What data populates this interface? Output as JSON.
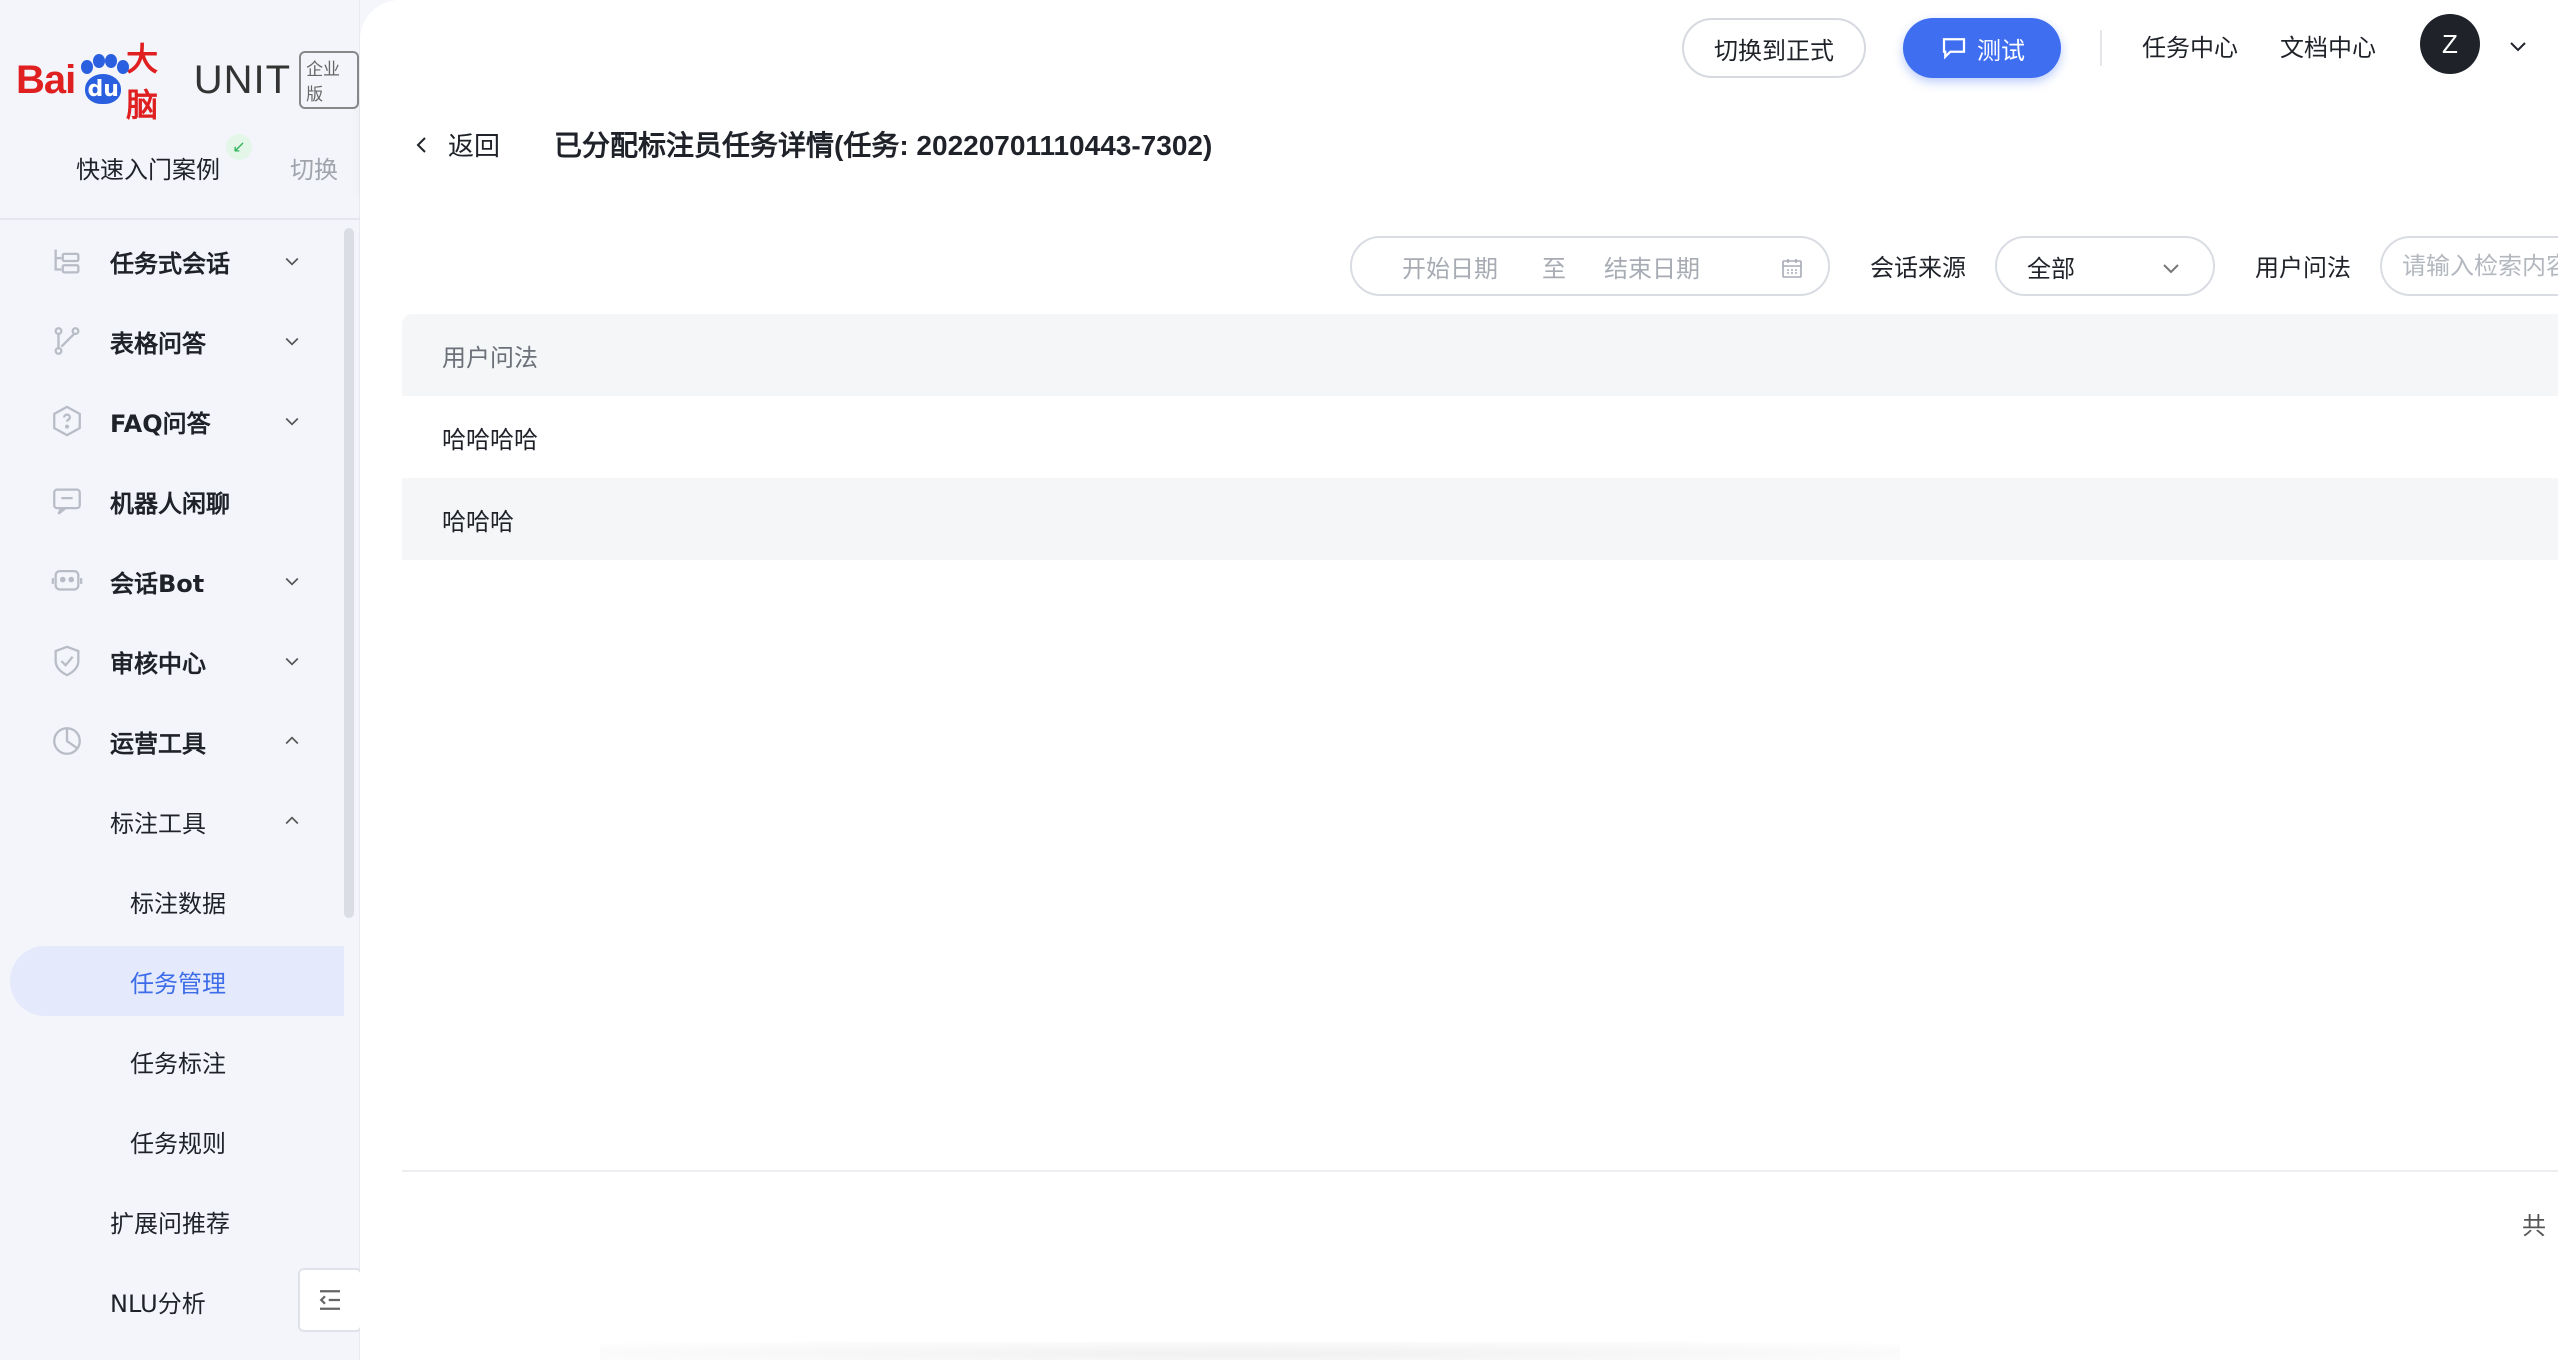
{
  "brand": {
    "bai": "Bai",
    "du": "du",
    "danao": "大脑",
    "unit": "UNIT",
    "edition": "企业版"
  },
  "sidebar": {
    "quick_start": "快速入门案例",
    "switch": "切换",
    "items": [
      {
        "label": "任务式会话",
        "icon": "tree-icon",
        "expandable": true
      },
      {
        "label": "表格问答",
        "icon": "branch-icon",
        "expandable": true
      },
      {
        "label": "FAQ问答",
        "icon": "question-shield-icon",
        "expandable": true
      },
      {
        "label": "机器人闲聊",
        "icon": "chat-icon",
        "expandable": false
      },
      {
        "label": "会话Bot",
        "icon": "robot-icon",
        "expandable": true
      },
      {
        "label": "审核中心",
        "icon": "shield-check-icon",
        "expandable": true
      },
      {
        "label": "运营工具",
        "icon": "pie-icon",
        "expandable": true,
        "expanded": true
      }
    ],
    "sub": {
      "annotation_tools": "标注工具",
      "annotation_data": "标注数据",
      "task_management": "任务管理",
      "task_annotation": "任务标注",
      "task_rules": "任务规则",
      "extension_recommend": "扩展问推荐",
      "nlu_analysis": "NLU分析"
    },
    "active": "任务管理"
  },
  "topbar": {
    "switch_formal": "切换到正式",
    "test": "测试",
    "task_center": "任务中心",
    "doc_center": "文档中心",
    "avatar_letter": "Z"
  },
  "page": {
    "back": "返回",
    "title": "已分配标注员任务详情(任务: 20220701110443-7302)"
  },
  "filters": {
    "start_date": "开始日期",
    "to": "至",
    "end_date": "结束日期",
    "source_label": "会话来源",
    "source_value": "全部",
    "query_label": "用户问法",
    "query_placeholder": "请输入检索内容"
  },
  "table": {
    "header": "用户问法",
    "rows": [
      "哈哈哈哈",
      "哈哈哈"
    ]
  },
  "footer": {
    "total": "共"
  },
  "colors": {
    "primary": "#3f6ff0",
    "active_bg": "#e4eafc",
    "brand_red": "#e02020",
    "brand_blue": "#2a5fe0"
  }
}
